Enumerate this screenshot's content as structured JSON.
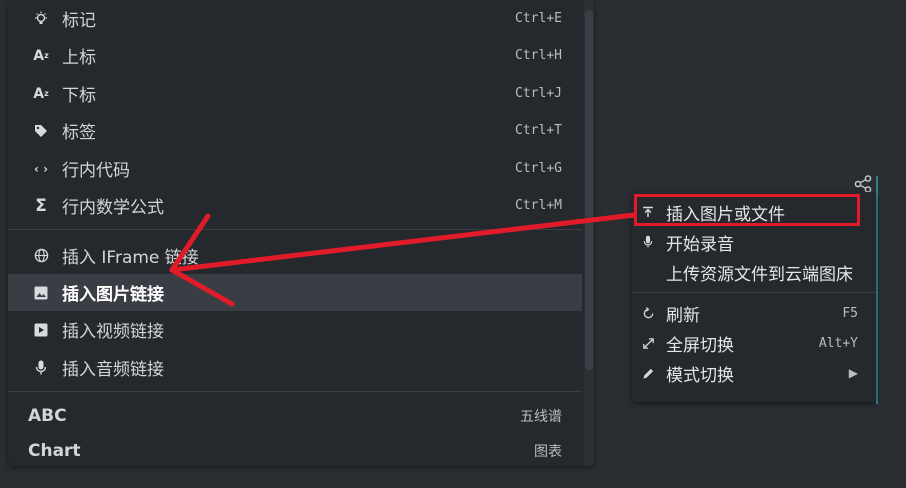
{
  "left_menu": {
    "items": [
      {
        "icon": "bulb-icon",
        "label": "标记",
        "shortcut": "Ctrl+E"
      },
      {
        "icon": "superscript-icon",
        "label": "上标",
        "shortcut": "Ctrl+H"
      },
      {
        "icon": "subscript-icon",
        "label": "下标",
        "shortcut": "Ctrl+J"
      },
      {
        "icon": "tag-icon",
        "label": "标签",
        "shortcut": "Ctrl+T"
      },
      {
        "icon": "code-icon",
        "label": "行内代码",
        "shortcut": "Ctrl+G"
      },
      {
        "icon": "sigma-icon",
        "label": "行内数学公式",
        "shortcut": "Ctrl+M"
      },
      {
        "icon": "globe-icon",
        "label": "插入 IFrame 链接",
        "shortcut": ""
      },
      {
        "icon": "image-icon",
        "label": "插入图片链接",
        "shortcut": "",
        "active": true
      },
      {
        "icon": "video-icon",
        "label": "插入视频链接",
        "shortcut": ""
      },
      {
        "icon": "mic-icon",
        "label": "插入音频链接",
        "shortcut": ""
      }
    ],
    "extras": [
      {
        "label": "ABC",
        "right": "五线谱"
      },
      {
        "label": "Chart",
        "right": "图表"
      }
    ]
  },
  "right_menu": {
    "items": [
      {
        "icon": "upload-icon",
        "label": "插入图片或文件",
        "shortcut": ""
      },
      {
        "icon": "mic-icon",
        "label": "开始录音",
        "shortcut": ""
      },
      {
        "icon": "",
        "label": "上传资源文件到云端图床",
        "shortcut": ""
      },
      {
        "icon": "refresh-icon",
        "label": "刷新",
        "shortcut": "F5"
      },
      {
        "icon": "expand-icon",
        "label": "全屏切换",
        "shortcut": "Alt+Y"
      },
      {
        "icon": "pencil-icon",
        "label": "模式切换",
        "shortcut": "▶"
      }
    ]
  },
  "colors": {
    "highlight": "#e21b2a",
    "active_bg": "#3a3e44",
    "menu_bg": "#25282c"
  }
}
